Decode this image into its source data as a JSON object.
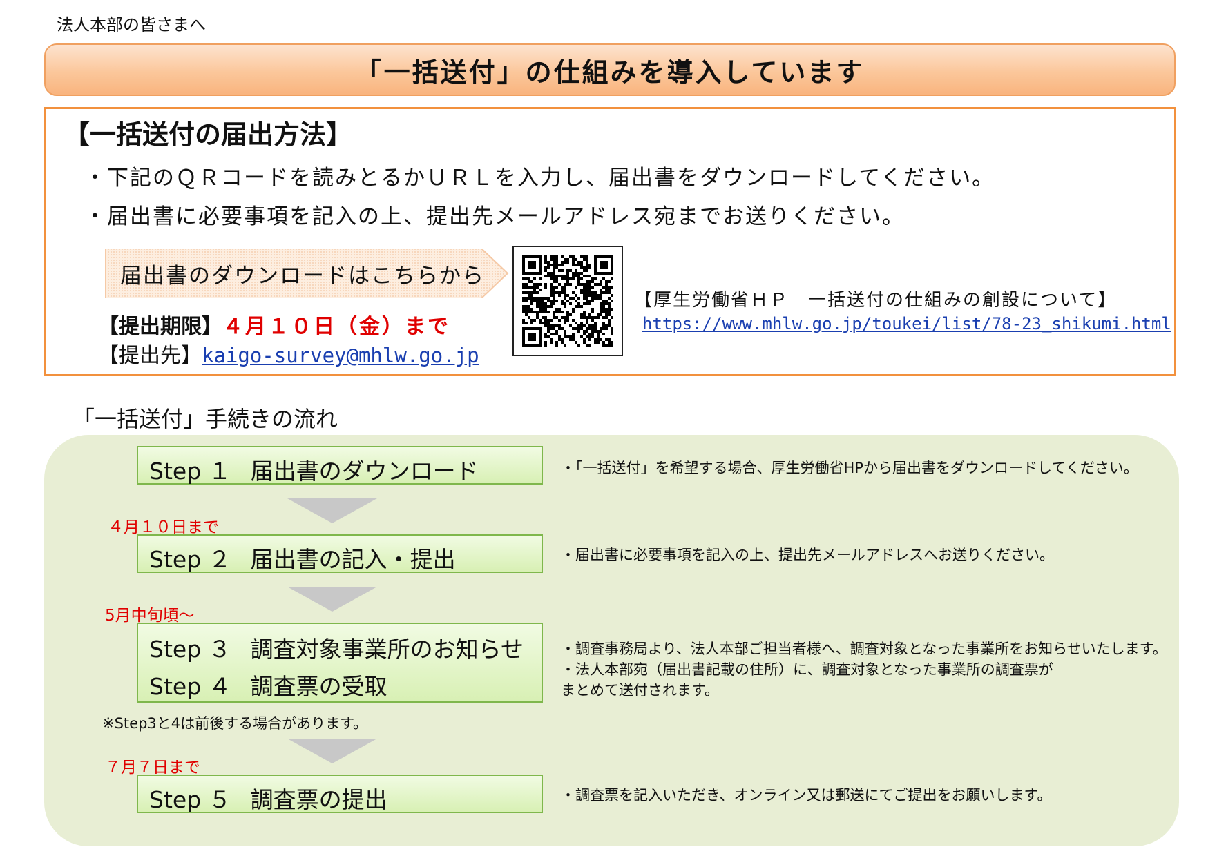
{
  "greeting": "法人本部の皆さまへ",
  "title": "「一括送付」の仕組みを導入しています",
  "method": {
    "heading": "【一括送付の届出方法】",
    "bullets": [
      "・下記のＱＲコードを読みとるかＵＲＬを入力し、届出書をダウンロードしてください。",
      "・届出書に必要事項を記入の上、提出先メールアドレス宛までお送りください。"
    ],
    "download_label": "届出書のダウンロードはこちらから",
    "deadline_label": "【提出期限】",
    "deadline_value": "４月１０日（金）まで",
    "submit_label": "【提出先】",
    "submit_email": "kaigo-survey@mhlw.go.jp",
    "hp_heading": "【厚生労働省ＨＰ　一括送付の仕組みの創設について】",
    "hp_url": "https://www.mhlw.go.jp/toukei/list/78-23_shikumi.html"
  },
  "flow": {
    "heading": "「一括送付」手続きの流れ",
    "steps": [
      {
        "id": "Step １",
        "name": "届出書のダウンロード"
      },
      {
        "id": "Step ２",
        "name": "届出書の記入・提出"
      },
      {
        "id": "Step ３",
        "name": "調査対象事業所のお知らせ"
      },
      {
        "id": "Step ４",
        "name": "調査票の受取"
      },
      {
        "id": "Step ５",
        "name": "調査票の提出"
      }
    ],
    "dates": [
      "４月１０日まで",
      "5月中旬頃～",
      "７月７日まで"
    ],
    "note": "※Step3と4は前後する場合があります。",
    "descriptions": [
      "・「一括送付」を希望する場合、厚生労働省HPから届出書をダウンロードしてください。",
      "・届出書に必要事項を記入の上、提出先メールアドレスへお送りください。",
      "・調査事務局より、法人本部ご担当者様へ、調査対象となった事業所をお知らせいたします。",
      "・法人本部宛（届出書記載の住所）に、調査対象となった事業所の調査票が",
      "まとめて送付されます。",
      "・調査票を記入いただき、オンライン又は郵送にてご提出をお願いします。"
    ]
  },
  "colors": {
    "accent_orange": "#f2913d",
    "deadline_red": "#e00000",
    "step_green": "#7fb74c",
    "panel_green": "#e8eed4",
    "link_blue": "#1a3fb0"
  },
  "icons": {
    "qr": "qr-code-icon",
    "arrow": "chevron-down-icon",
    "banner": "arrow-banner-icon"
  }
}
